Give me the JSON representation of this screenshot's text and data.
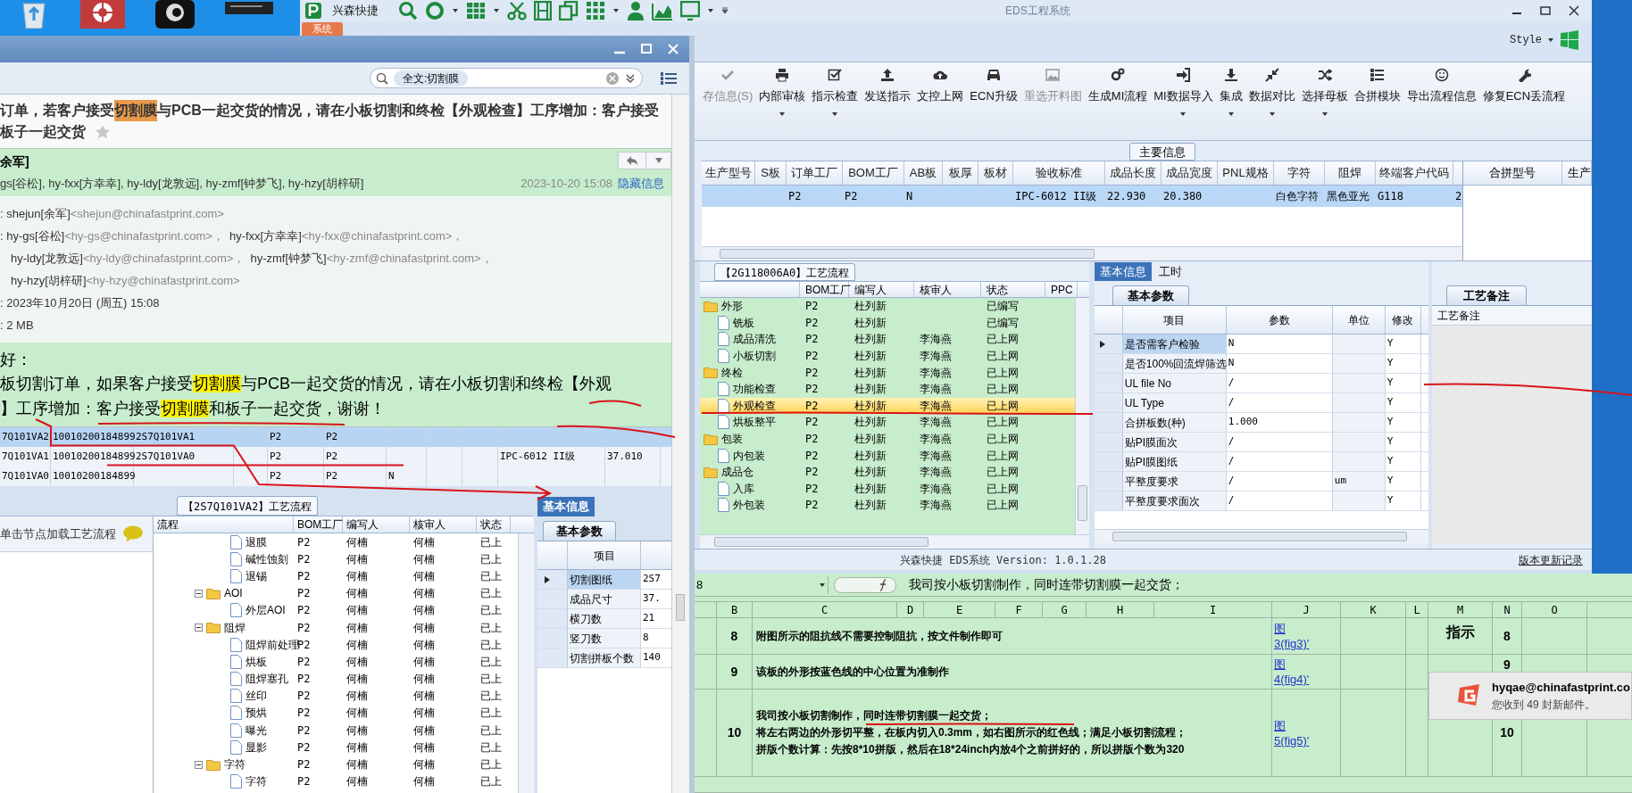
{
  "app": {
    "title": "EDS工程系统",
    "quick_label": "兴森快捷",
    "menu_tab": "系统",
    "style_label": "Style",
    "ribbon": [
      {
        "label": "存信息(S)",
        "disabled": true,
        "dropdown": false
      },
      {
        "label": "内部审核",
        "disabled": false,
        "dropdown": true
      },
      {
        "label": "指示检查",
        "disabled": false,
        "dropdown": true
      },
      {
        "label": "发送指示",
        "disabled": false,
        "dropdown": false
      },
      {
        "label": "文控上网",
        "disabled": false,
        "dropdown": false
      },
      {
        "label": "ECN升级",
        "disabled": false,
        "dropdown": false
      },
      {
        "label": "重选开料图",
        "disabled": true,
        "dropdown": false
      },
      {
        "label": "生成MI流程",
        "disabled": false,
        "dropdown": false
      },
      {
        "label": "MI数据导入",
        "disabled": false,
        "dropdown": true
      },
      {
        "label": "集成",
        "disabled": false,
        "dropdown": true
      },
      {
        "label": "数据对比",
        "disabled": false,
        "dropdown": true
      },
      {
        "label": "选择母板",
        "disabled": false,
        "dropdown": true
      },
      {
        "label": "合拼模块",
        "disabled": false,
        "dropdown": false
      },
      {
        "label": "导出流程信息",
        "disabled": false,
        "dropdown": false
      },
      {
        "label": "修复ECN丢流程",
        "disabled": false,
        "dropdown": false
      }
    ],
    "main_info": {
      "title": "主要信息",
      "columns": [
        "生产型号",
        "S板",
        "订单工厂",
        "BOM工厂",
        "AB板",
        "板厚",
        "板材",
        "验收标准",
        "成品长度",
        "成品宽度",
        "PNL规格",
        "字符",
        "阻焊",
        "终端客户代码"
      ],
      "rows": [
        {
          "selected": true,
          "cells": [
            null,
            null,
            "P2",
            "P2",
            "N",
            null,
            null,
            "IPC-6012 II级",
            "22.930",
            "20.380",
            null,
            "白色字符",
            "黑色亚光",
            "G118",
            "2"
          ]
        }
      ]
    },
    "merge_panel": {
      "columns": [
        "合拼型号",
        "生产"
      ]
    },
    "process": {
      "title": "【2G118006A0】工艺流程",
      "columns": [
        "BOM工厂",
        "编写人",
        "核审人",
        "状态",
        "PPC"
      ],
      "tree": [
        {
          "label": "外形",
          "kind": "folder",
          "bom": "P2",
          "writer": "杜列新",
          "status": "已编写",
          "selected": false,
          "children": [
            {
              "label": "铣板",
              "kind": "file",
              "bom": "P2",
              "writer": "杜列新",
              "status": "已编写",
              "selected": false
            },
            {
              "label": "成品清洗",
              "kind": "file",
              "bom": "P2",
              "writer": "杜列新",
              "reviewer": "李海燕",
              "status": "已上网",
              "selected": false
            },
            {
              "label": "小板切割",
              "kind": "file",
              "bom": "P2",
              "writer": "杜列新",
              "reviewer": "李海燕",
              "status": "已上网",
              "selected": false
            }
          ]
        },
        {
          "label": "终检",
          "kind": "folder",
          "bom": "P2",
          "writer": "杜列新",
          "reviewer": "李海燕",
          "status": "已上网",
          "selected": false,
          "children": [
            {
              "label": "功能检查",
              "kind": "file",
              "bom": "P2",
              "writer": "杜列新",
              "reviewer": "李海燕",
              "status": "已上网",
              "selected": false
            },
            {
              "label": "外观检查",
              "kind": "file",
              "bom": "P2",
              "writer": "杜列新",
              "reviewer": "李海燕",
              "status": "已上网",
              "selected": true
            },
            {
              "label": "烘板整平",
              "kind": "file",
              "bom": "P2",
              "writer": "杜列新",
              "reviewer": "李海燕",
              "status": "已上网",
              "selected": false
            }
          ]
        },
        {
          "label": "包装",
          "kind": "folder",
          "bom": "P2",
          "writer": "杜列新",
          "reviewer": "李海燕",
          "status": "已上网",
          "selected": false,
          "children": [
            {
              "label": "内包装",
              "kind": "file",
              "bom": "P2",
              "writer": "杜列新",
              "reviewer": "李海燕",
              "status": "已上网",
              "selected": false
            }
          ]
        },
        {
          "label": "成品仓",
          "kind": "folder",
          "bom": "P2",
          "writer": "杜列新",
          "reviewer": "李海燕",
          "status": "已上网",
          "selected": false,
          "children": [
            {
              "label": "入库",
              "kind": "file",
              "bom": "P2",
              "writer": "杜列新",
              "reviewer": "李海燕",
              "status": "已上网",
              "selected": false
            },
            {
              "label": "外包装",
              "kind": "file",
              "bom": "P2",
              "writer": "杜列新",
              "reviewer": "李海燕",
              "status": "已上网",
              "selected": false
            }
          ]
        }
      ]
    },
    "info_tabs": [
      {
        "label": "基本信息",
        "selected": true
      },
      {
        "label": "工时",
        "selected": false
      }
    ],
    "params": {
      "tab": "基本参数",
      "columns": [
        "项目",
        "参数",
        "单位",
        "修改"
      ],
      "rows": [
        {
          "item": "是否需客户检验",
          "value": "N",
          "modified": "Y",
          "selected": true
        },
        {
          "item": "是否100%回流焊筛选",
          "value": "N",
          "modified": "Y",
          "selected": false
        },
        {
          "item": "UL file No",
          "value": "/",
          "modified": "Y",
          "selected": false
        },
        {
          "item": "UL Type",
          "value": "/",
          "modified": "Y",
          "selected": false
        },
        {
          "item": "合拼板数(种)",
          "value": "1.000",
          "modified": "Y",
          "selected": false
        },
        {
          "item": "贴PI膜面次",
          "value": "/",
          "modified": "Y",
          "selected": false
        },
        {
          "item": "贴PI膜图纸",
          "value": "/",
          "modified": "Y",
          "selected": false
        },
        {
          "item": "平整度要求",
          "value": "/",
          "unit": "um",
          "modified": "Y",
          "selected": false
        },
        {
          "item": "平整度要求面次",
          "value": "/",
          "modified": "Y",
          "selected": false
        }
      ]
    },
    "notes": {
      "tab": "工艺备注",
      "header": "工艺备注"
    },
    "status_bar": {
      "version": "兴森快捷 EDS系统 Version: 1.0.1.28",
      "link": "版本更新记录"
    }
  },
  "email": {
    "search": {
      "value": "全文:切割膜"
    },
    "subject_lines": [
      [
        {
          "text": "订单，若客户接受",
          "highlight": false
        },
        {
          "text": "切割膜",
          "highlight": true
        },
        {
          "text": "与PCB一起交货的情况，请在小板切割和终检【外观检查】工序增加：客户接受",
          "highlight": false
        }
      ],
      [
        {
          "text": "板子一起交货",
          "highlight": false
        }
      ]
    ],
    "starred": false,
    "sender": "余军]",
    "recipients": "gs[谷松], hy-fxx[方幸幸], hy-ldy[龙敦远], hy-zmf[钟梦飞], hy-hzy[胡梓研]",
    "date": "2023-10-20 15:08",
    "hide_link": "隐藏信息",
    "details": [
      [
        {
          "text": ": shejun[余军]",
          "kind": "name"
        },
        {
          "text": "<shejun@chinafastprint.com>",
          "kind": "address"
        }
      ],
      [
        {
          "text": ": hy-gs[谷松]",
          "kind": "name"
        },
        {
          "text": "<hy-gs@chinafastprint.com>，",
          "kind": "address"
        },
        {
          "text": "hy-fxx[方幸幸]",
          "kind": "name"
        },
        {
          "text": "<hy-fxx@chinafastprint.com>，",
          "kind": "address"
        }
      ],
      [
        {
          "text": "hy-ldy[龙敦远]",
          "kind": "name"
        },
        {
          "text": "<hy-ldy@chinafastprint.com>，",
          "kind": "address"
        },
        {
          "text": "hy-zmf[钟梦飞]",
          "kind": "name"
        },
        {
          "text": "<hy-zmf@chinafastprint.com>，",
          "kind": "address"
        }
      ],
      [
        {
          "text": "hy-hzy[胡梓研]",
          "kind": "name"
        },
        {
          "text": "<hy-hzy@chinafastprint.com>",
          "kind": "address"
        }
      ],
      [
        {
          "text": ": 2023年10月20日 (周五) 15:08",
          "kind": "name"
        }
      ],
      [
        {
          "text": ": 2 MB",
          "kind": "name"
        }
      ]
    ],
    "greeting": "好：",
    "body_lines": [
      [
        {
          "text": "板切割订单，如果客户接受",
          "highlight": false
        },
        {
          "text": "切割膜",
          "highlight": true
        },
        {
          "text": "与PCB一起交货的情况，请在小板切割和终检【外观",
          "highlight": false
        }
      ],
      [
        {
          "text": "】工序增加：客户接受",
          "highlight": false
        },
        {
          "text": "切割膜",
          "highlight": true
        },
        {
          "text": "和板子一起交货，谢谢！",
          "highlight": false
        }
      ]
    ],
    "screenshot": {
      "grid_rows": [
        {
          "selected": true,
          "cells": [
            "7Q101VA2",
            "10010200184899",
            "2S7Q101VA1",
            null,
            "P2",
            "P2",
            null,
            null,
            null,
            null,
            null
          ]
        },
        {
          "selected": false,
          "cells": [
            "7Q101VA1",
            "10010200184899",
            "2S7Q101VA0",
            null,
            "P2",
            "P2",
            null,
            null,
            null,
            "IPC-6012 II级",
            "37.010"
          ]
        },
        {
          "selected": false,
          "cells": [
            "7Q101VA0",
            "10010200184899",
            null,
            null,
            "P2",
            "P2",
            "N",
            null,
            null,
            null,
            null
          ]
        }
      ],
      "process_title": "【2S7Q101VA2】工艺流程",
      "hint": "单击节点加载工艺流程",
      "columns": [
        "流程",
        "BOM工厂",
        "编写人",
        "核审人",
        "状态"
      ],
      "tree": [
        {
          "label": "退膜",
          "kind": "file",
          "bom": "P2",
          "writer": "何楠",
          "reviewer": "何楠",
          "status": "已上"
        },
        {
          "label": "碱性蚀刻",
          "kind": "file",
          "bom": "P2",
          "writer": "何楠",
          "reviewer": "何楠",
          "status": "已上"
        },
        {
          "label": "退锡",
          "kind": "file",
          "bom": "P2",
          "writer": "何楠",
          "reviewer": "何楠",
          "status": "已上"
        },
        {
          "label": "AOI",
          "kind": "folder",
          "expanded": true,
          "bom": "P2",
          "writer": "何楠",
          "reviewer": "何楠",
          "status": "已上",
          "children": [
            {
              "label": "外层AOI",
              "kind": "file",
              "bom": "P2",
              "writer": "何楠",
              "reviewer": "何楠",
              "status": "已上"
            }
          ]
        },
        {
          "label": "阻焊",
          "kind": "folder",
          "expanded": true,
          "bom": "P2",
          "writer": "何楠",
          "reviewer": "何楠",
          "status": "已上",
          "children": [
            {
              "label": "阻焊前处理",
              "kind": "file",
              "bom": "P2",
              "writer": "何楠",
              "reviewer": "何楠",
              "status": "已上"
            },
            {
              "label": "烘板",
              "kind": "file",
              "bom": "P2",
              "writer": "何楠",
              "reviewer": "何楠",
              "status": "已上"
            },
            {
              "label": "阻焊塞孔",
              "kind": "file",
              "bom": "P2",
              "writer": "何楠",
              "reviewer": "何楠",
              "status": "已上"
            },
            {
              "label": "丝印",
              "kind": "file",
              "bom": "P2",
              "writer": "何楠",
              "reviewer": "何楠",
              "status": "已上"
            },
            {
              "label": "预烘",
              "kind": "file",
              "bom": "P2",
              "writer": "何楠",
              "reviewer": "何楠",
              "status": "已上"
            },
            {
              "label": "曝光",
              "kind": "file",
              "bom": "P2",
              "writer": "何楠",
              "reviewer": "何楠",
              "status": "已上"
            },
            {
              "label": "显影",
              "kind": "file",
              "bom": "P2",
              "writer": "何楠",
              "reviewer": "何楠",
              "status": "已上"
            }
          ]
        },
        {
          "label": "字符",
          "kind": "folder",
          "expanded": true,
          "bom": "P2",
          "writer": "何楠",
          "reviewer": "何楠",
          "status": "已上",
          "children": [
            {
              "label": "字符",
              "kind": "file",
              "bom": "P2",
              "writer": "何楠",
              "reviewer": "何楠",
              "status": "已上"
            }
          ]
        }
      ],
      "info_tab": "基本信息",
      "params_tab": "基本参数",
      "params_column": "项目",
      "params": [
        {
          "item": "切割图纸",
          "value": "2S7",
          "selected": true
        },
        {
          "item": "成品尺寸",
          "value": "37.",
          "selected": false
        },
        {
          "item": "横刀数",
          "value": "21",
          "selected": false
        },
        {
          "item": "竖刀数",
          "value": "8",
          "selected": false
        },
        {
          "item": "切割拼板个数",
          "value": "140",
          "selected": false
        }
      ]
    }
  },
  "spreadsheet": {
    "name_box": "8",
    "formula": "我司按小板切割制作，同时连带切割膜一起交货；",
    "columns": [
      "B",
      "C",
      "D",
      "E",
      "F",
      "G",
      "H",
      "I",
      "J",
      "K",
      "L",
      "M",
      "N",
      "O"
    ],
    "cam_label": "指示",
    "rows": [
      {
        "num": "8",
        "text": [
          "附图所示的阻抗线不需要控制阻抗，按文件制作即可"
        ],
        "link": [
          "图",
          "3(fig3)'"
        ],
        "n": "8"
      },
      {
        "num": "9",
        "text": [
          "该板的外形按蓝色线的中心位置为准制作"
        ],
        "link": [
          "图",
          "4(fig4)'"
        ],
        "n": "9"
      },
      {
        "num": "10",
        "text": [
          "我司按小板切割制作，同时连带切割膜一起交货；",
          "将左右两边的外形切平整，在板内切入0.3mm，如右图所示的红色线；满足小板切割流程；",
          "拼版个数计算：先按8*10拼版，然后在18*24inch内放4个之前拼好的，所以拼版个数为320"
        ],
        "link": [
          "图",
          "5(fig5)'"
        ],
        "n": "10"
      }
    ]
  },
  "notification": {
    "sender": "hyqae@chinafastprint.co",
    "message": "您收到 49 封新邮件。"
  }
}
